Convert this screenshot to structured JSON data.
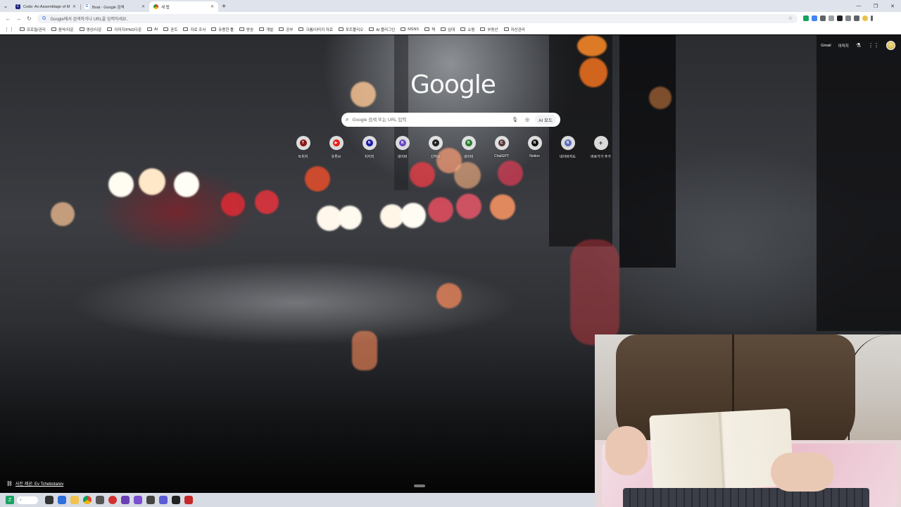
{
  "tabs": [
    {
      "title": "Code: An Assemblage of Man",
      "favicon": "book-icon",
      "favicon_color": "#1a237e",
      "active": false
    },
    {
      "title": "Boat - Google 검색",
      "favicon": "google-icon",
      "favicon_color": "#ffffff",
      "active": false
    },
    {
      "title": "새 탭",
      "favicon": "chrome-icon",
      "favicon_color": "#ffffff",
      "active": true
    }
  ],
  "toolbar": {
    "omnibox_placeholder": "Google에서 검색하거나 URL을 입력하세요.",
    "omnibox_icon": "G"
  },
  "bookmarks": [
    "프로필/관리",
    "음악/다운",
    "영상/다운",
    "이미지/PNG다운",
    "AI",
    "폰트",
    "자료 조사",
    "유용한 툴",
    "방송",
    "개발",
    "공부",
    "크롬/이미지 자료",
    "포트폴리오",
    "AI 플러그인",
    "MSNS",
    "책",
    "임대",
    "쇼핑",
    "부동산",
    "자산관리"
  ],
  "top_links": {
    "gmail": "Gmail",
    "images": "이미지"
  },
  "logo": "Google",
  "search": {
    "placeholder": "Google 검색 또는 URL 입력",
    "ai_mode_label": "AI 모드"
  },
  "shortcuts": [
    {
      "label": "트위치",
      "letter": "T",
      "color": "#8b1a1a"
    },
    {
      "label": "유튜브",
      "letter": "▶",
      "color": "#e62117"
    },
    {
      "label": "치지직",
      "letter": "N",
      "color": "#1a1aa8"
    },
    {
      "label": "네이버",
      "letter": "N",
      "color": "#6a4bc4"
    },
    {
      "label": "깃허브",
      "letter": "●",
      "color": "#222222"
    },
    {
      "label": "네이버",
      "letter": "N",
      "color": "#2e7d32"
    },
    {
      "label": "ChatGPT",
      "letter": "C",
      "color": "#5a3a3a"
    },
    {
      "label": "Notion",
      "letter": "N",
      "color": "#111111"
    },
    {
      "label": "네이버지도",
      "letter": "N",
      "color": "#5c6bc0"
    },
    {
      "label": "바로가기 추가",
      "letter": "+",
      "color": "#555555"
    }
  ],
  "credit": "사진 제공: Ev Tchebotarev",
  "colors": {
    "tab_strip": "#dfe3eb",
    "taskbar": "#d7dbe4",
    "accent": "#1a73e8"
  }
}
